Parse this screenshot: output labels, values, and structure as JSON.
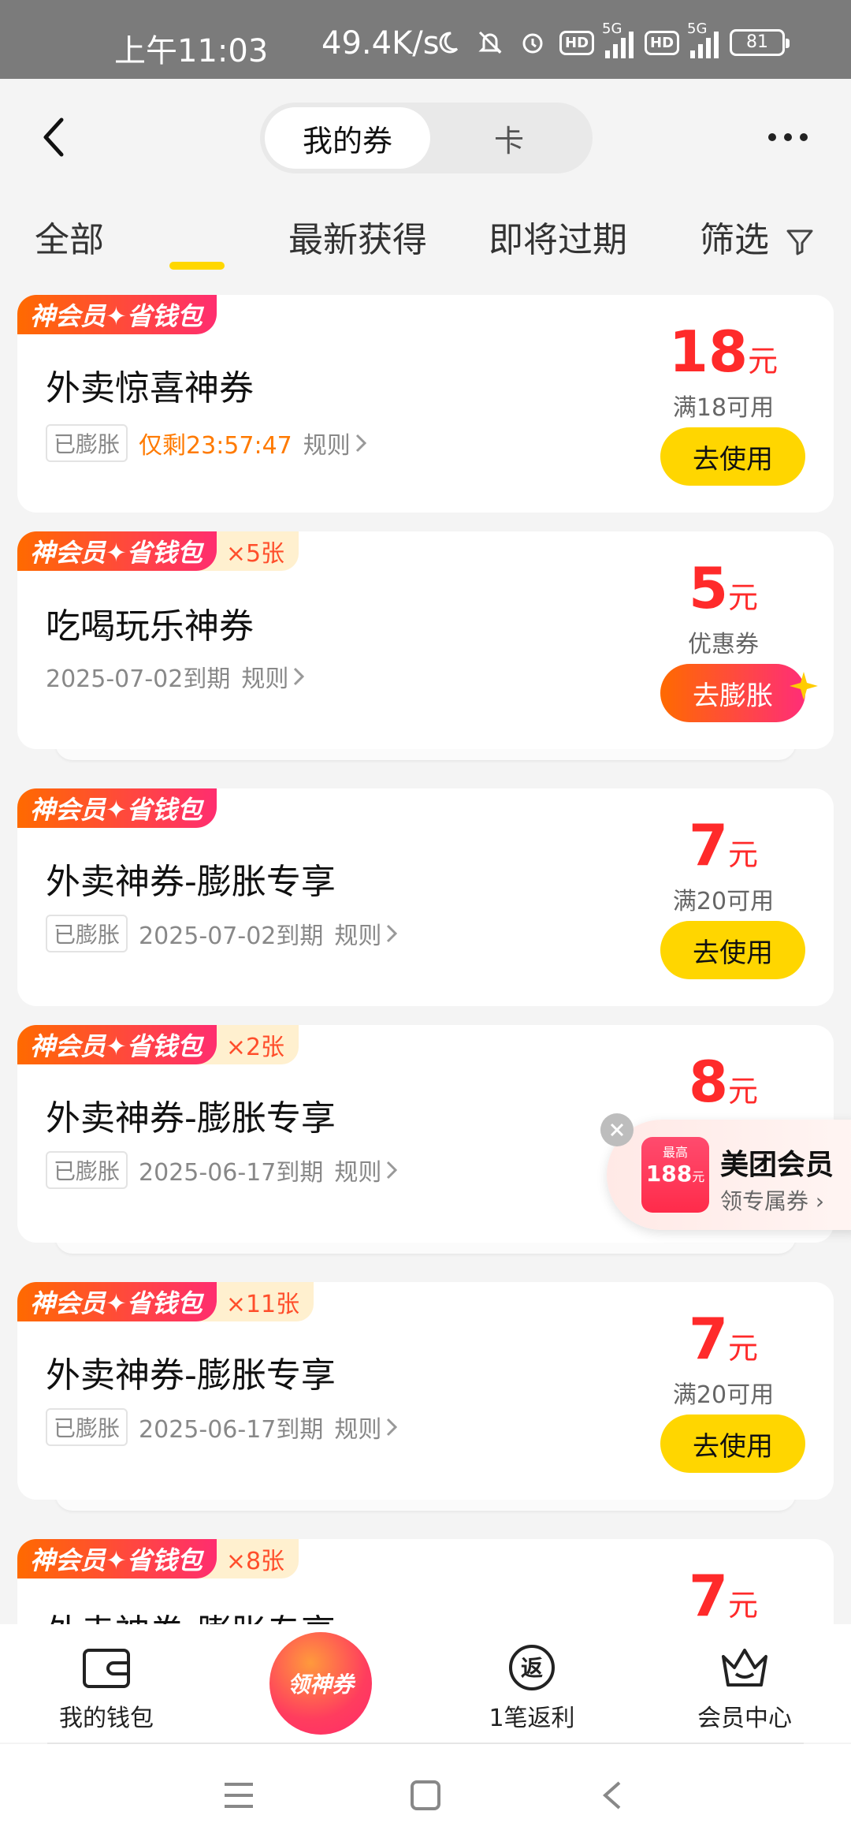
{
  "status": {
    "time": "上午11:03",
    "speed": "49.4K/s",
    "net1": "5G",
    "net2": "5G",
    "battery": "81"
  },
  "header": {
    "tab_coupons": "我的券",
    "tab_cards": "卡"
  },
  "filters": {
    "all": "全部",
    "latest": "最新获得",
    "expiring": "即将过期",
    "filter": "筛选"
  },
  "brand_label": "神会员✦省钱包",
  "coupons": [
    {
      "title": "外卖惊喜神券",
      "tag": "已膨胀",
      "countdown": "仅剩23:57:47",
      "rule": "规则",
      "amount": "18",
      "unit": "元",
      "condition": "满18可用",
      "action": "去使用"
    },
    {
      "title": "吃喝玩乐神券",
      "count": "×5张",
      "expiry": "2025-07-02到期",
      "rule": "规则",
      "amount": "5",
      "unit": "元",
      "condition": "优惠券",
      "action": "去膨胀"
    },
    {
      "title": "外卖神券-膨胀专享",
      "tag": "已膨胀",
      "expiry": "2025-07-02到期",
      "rule": "规则",
      "amount": "7",
      "unit": "元",
      "condition": "满20可用",
      "action": "去使用"
    },
    {
      "title": "外卖神券-膨胀专享",
      "count": "×2张",
      "tag": "已膨胀",
      "expiry": "2025-06-17到期",
      "rule": "规则",
      "amount": "8",
      "unit": "元"
    },
    {
      "title": "外卖神券-膨胀专享",
      "count": "×11张",
      "tag": "已膨胀",
      "expiry": "2025-06-17到期",
      "rule": "规则",
      "amount": "7",
      "unit": "元",
      "condition": "满20可用",
      "action": "去使用"
    },
    {
      "title": "外卖神券-膨胀专享",
      "count": "×8张",
      "amount": "7",
      "unit": "元"
    }
  ],
  "promo": {
    "badge_top": "最高",
    "badge_value": "188",
    "badge_unit": "元",
    "title": "美团会员",
    "subtitle": "领专属券"
  },
  "tabbar": {
    "wallet": "我的钱包",
    "center": "领神券",
    "rebate": "1笔返利",
    "member": "会员中心",
    "rebate_glyph": "返"
  },
  "colors": {
    "accent_yellow": "#ffd600",
    "price_red": "#ff2a2a",
    "brand_gradient_start": "#ff6a00",
    "brand_gradient_end": "#ff2d6f",
    "countdown_orange": "#ff7a00"
  }
}
